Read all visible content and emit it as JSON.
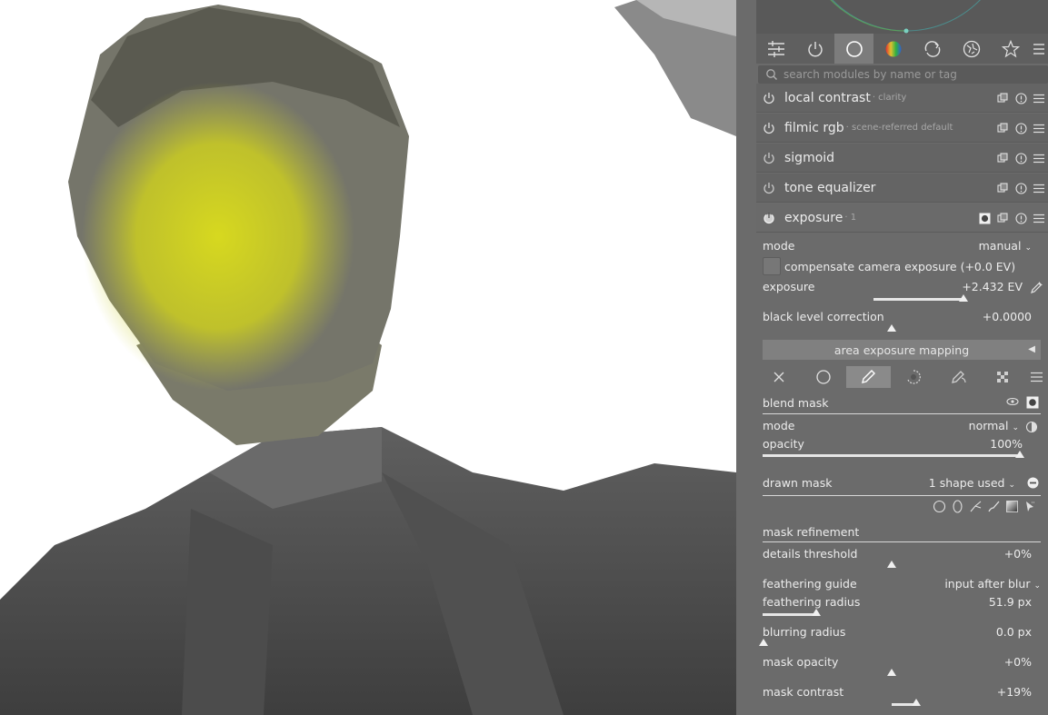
{
  "search": {
    "placeholder": "search modules by name or tag"
  },
  "group_tabs": [
    "quick-access-icon",
    "active-modules-icon",
    "base-group-icon",
    "color-group-icon",
    "correct-group-icon",
    "effects-group-icon",
    "favorites-icon",
    "presets-menu-icon"
  ],
  "modules": [
    {
      "name": "local contrast",
      "label": "· clarity"
    },
    {
      "name": "filmic rgb",
      "label": "· scene-referred default"
    },
    {
      "name": "sigmoid",
      "label": ""
    },
    {
      "name": "tone equalizer",
      "label": ""
    },
    {
      "name": "exposure",
      "label": "· 1"
    }
  ],
  "exposure": {
    "mode_label": "mode",
    "mode_value": "manual",
    "compensate_label": "compensate camera exposure (+0.0 EV)",
    "compensate_checked": false,
    "exposure_label": "exposure",
    "exposure_value": "+2.432 EV",
    "exposure_level": 0.82,
    "black_label": "black level correction",
    "black_value": "+0.0000",
    "black_level": 0.5,
    "area_mapping_label": "area exposure mapping"
  },
  "blend_tabs": [
    "off-icon",
    "uniformly-icon",
    "drawn-mask-icon",
    "parametric-mask-icon",
    "drawn-parametric-mask-icon",
    "raster-mask-icon",
    "blend-menu-icon"
  ],
  "blend": {
    "title": "blend mask",
    "mode_label": "mode",
    "mode_value": "normal",
    "opacity_label": "opacity",
    "opacity_value": "100%",
    "opacity_level": 1.0,
    "drawn_mask_label": "drawn mask",
    "drawn_mask_value": "1 shape used",
    "shape_tools": [
      "circle-icon",
      "ellipse-icon",
      "path-icon",
      "brush-icon",
      "gradient-icon",
      "edit-shapes-icon"
    ]
  },
  "refinement": {
    "title": "mask refinement",
    "details_label": "details threshold",
    "details_value": "+0%",
    "details_level": 0.5,
    "guide_label": "feathering guide",
    "guide_value": "input after blur",
    "feather_label": "feathering radius",
    "feather_value": "51.9 px",
    "feather_level": 0.2,
    "blur_label": "blurring radius",
    "blur_value": "0.0 px",
    "blur_level": 0.0,
    "mask_opacity_label": "mask opacity",
    "mask_opacity_value": "+0%",
    "mask_opacity_level": 0.5,
    "mask_contrast_label": "mask contrast",
    "mask_contrast_value": "+19%",
    "mask_contrast_level": 0.595
  },
  "colors": {
    "panel_bg": "#6b6b6b",
    "mask_overlay": "#e4e81c",
    "active_tab": "#7c7c7c"
  }
}
